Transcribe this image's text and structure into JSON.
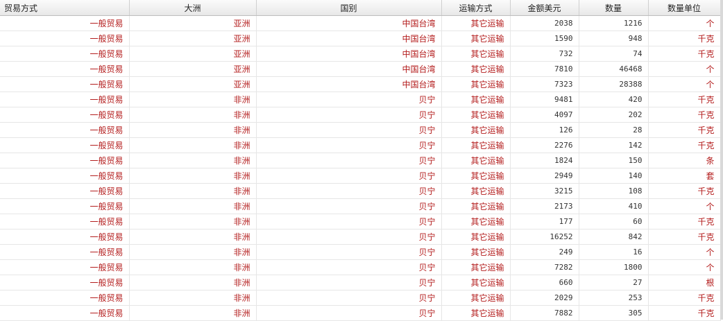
{
  "columns": [
    "贸易方式",
    "大洲",
    "国别",
    "运输方式",
    "金额美元",
    "数量",
    "数量单位"
  ],
  "rows": [
    [
      "一般贸易",
      "亚洲",
      "中国台湾",
      "其它运输",
      "2038",
      "1216",
      "个"
    ],
    [
      "一般贸易",
      "亚洲",
      "中国台湾",
      "其它运输",
      "1590",
      "948",
      "千克"
    ],
    [
      "一般贸易",
      "亚洲",
      "中国台湾",
      "其它运输",
      "732",
      "74",
      "千克"
    ],
    [
      "一般贸易",
      "亚洲",
      "中国台湾",
      "其它运输",
      "7810",
      "46468",
      "个"
    ],
    [
      "一般贸易",
      "亚洲",
      "中国台湾",
      "其它运输",
      "7323",
      "28388",
      "个"
    ],
    [
      "一般贸易",
      "非洲",
      "贝宁",
      "其它运输",
      "9481",
      "420",
      "千克"
    ],
    [
      "一般贸易",
      "非洲",
      "贝宁",
      "其它运输",
      "4097",
      "202",
      "千克"
    ],
    [
      "一般贸易",
      "非洲",
      "贝宁",
      "其它运输",
      "126",
      "28",
      "千克"
    ],
    [
      "一般贸易",
      "非洲",
      "贝宁",
      "其它运输",
      "2276",
      "142",
      "千克"
    ],
    [
      "一般贸易",
      "非洲",
      "贝宁",
      "其它运输",
      "1824",
      "150",
      "条"
    ],
    [
      "一般贸易",
      "非洲",
      "贝宁",
      "其它运输",
      "2949",
      "140",
      "套"
    ],
    [
      "一般贸易",
      "非洲",
      "贝宁",
      "其它运输",
      "3215",
      "108",
      "千克"
    ],
    [
      "一般贸易",
      "非洲",
      "贝宁",
      "其它运输",
      "2173",
      "410",
      "个"
    ],
    [
      "一般贸易",
      "非洲",
      "贝宁",
      "其它运输",
      "177",
      "60",
      "千克"
    ],
    [
      "一般贸易",
      "非洲",
      "贝宁",
      "其它运输",
      "16252",
      "842",
      "千克"
    ],
    [
      "一般贸易",
      "非洲",
      "贝宁",
      "其它运输",
      "249",
      "16",
      "个"
    ],
    [
      "一般贸易",
      "非洲",
      "贝宁",
      "其它运输",
      "7282",
      "1800",
      "个"
    ],
    [
      "一般贸易",
      "非洲",
      "贝宁",
      "其它运输",
      "660",
      "27",
      "根"
    ],
    [
      "一般贸易",
      "非洲",
      "贝宁",
      "其它运输",
      "2029",
      "253",
      "千克"
    ],
    [
      "一般贸易",
      "非洲",
      "贝宁",
      "其它运输",
      "7882",
      "305",
      "千克"
    ]
  ]
}
